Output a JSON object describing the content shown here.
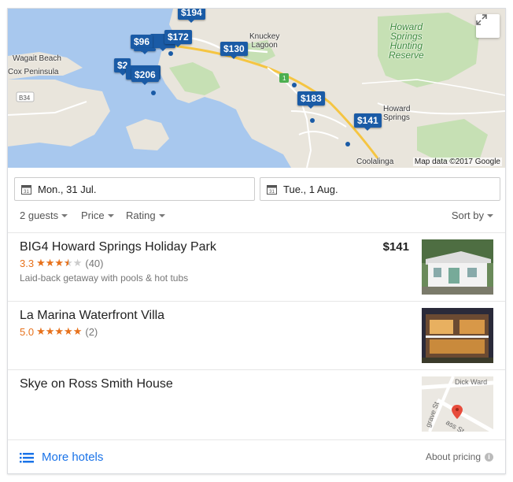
{
  "map": {
    "pins": [
      {
        "label": "$194"
      },
      {
        "label": "$96"
      },
      {
        "label": "$172"
      },
      {
        "label": "$130"
      },
      {
        "label": "$2"
      },
      {
        "label": "$206"
      },
      {
        "label": "$183"
      },
      {
        "label": "$141"
      }
    ],
    "places": {
      "wagait_beach": "Wagait Beach",
      "cox_peninsula": "Cox Peninsula",
      "road_b34": "B34",
      "knuckey_lagoon": "Knuckey\nLagoon",
      "howard_springs": "Howard\nSprings",
      "coolalinga": "Coolalinga",
      "reserve": "Howard\nSprings\nHunting\nReserve",
      "route_1": "1"
    },
    "attribution": "Map data ©2017 Google"
  },
  "dates": {
    "checkin": "Mon., 31 Jul.",
    "checkout": "Tue., 1 Aug.",
    "cal_number": "31"
  },
  "filters": {
    "guests": "2 guests",
    "price": "Price",
    "rating": "Rating",
    "sort": "Sort by"
  },
  "hotels": [
    {
      "name": "BIG4 Howard Springs Holiday Park",
      "rating": "3.3",
      "stars": 3.5,
      "reviews": "(40)",
      "description": "Laid-back getaway with pools & hot tubs",
      "price": "$141"
    },
    {
      "name": "La Marina Waterfront Villa",
      "rating": "5.0",
      "stars": 5,
      "reviews": "(2)",
      "description": "",
      "price": ""
    },
    {
      "name": "Skye on Ross Smith House",
      "rating": "",
      "reviews": "",
      "description": "",
      "price": "",
      "thumb_streets": [
        "Dick Ward",
        "grave St",
        "ass St"
      ]
    }
  ],
  "footer": {
    "more_hotels": "More hotels",
    "about_pricing": "About pricing",
    "info": "i"
  },
  "colors": {
    "pin": "#1a5ba6",
    "link": "#1a73e8",
    "star": "#e7711b",
    "water": "#a8c8ee"
  }
}
